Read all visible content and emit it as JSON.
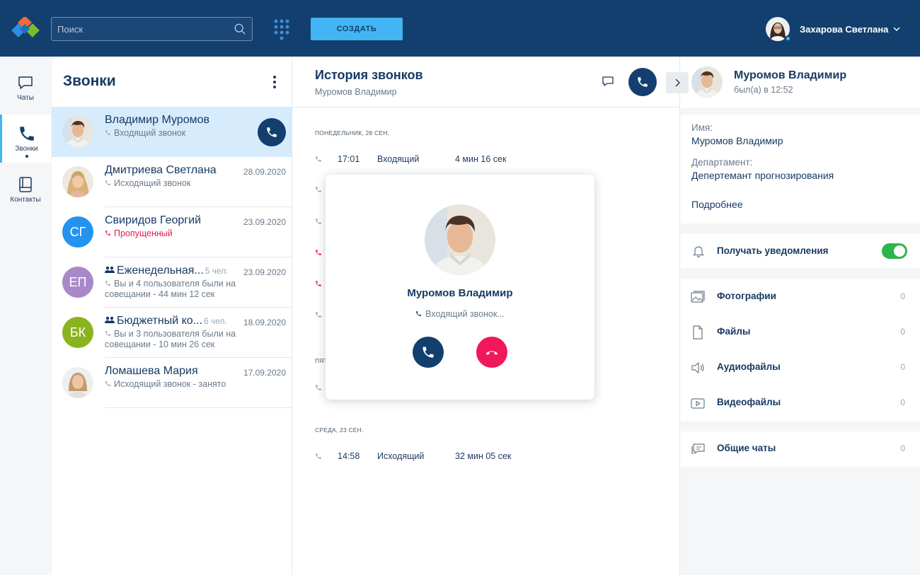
{
  "header": {
    "search_placeholder": "Поиск",
    "create_label": "СОЗДАТЬ",
    "user_name": "Захарова Светлана"
  },
  "rail": {
    "items": [
      {
        "label": "Чаты",
        "icon": "chat-icon"
      },
      {
        "label": "Звонки",
        "icon": "phone-icon"
      },
      {
        "label": "Контакты",
        "icon": "contacts-book-icon"
      }
    ]
  },
  "calls": {
    "title": "Звонки",
    "items": [
      {
        "name": "Владимир Муромов",
        "date": "",
        "sub": "Входящий звонок",
        "type": "incoming",
        "selected": true
      },
      {
        "name": "Дмитриева Светлана",
        "date": "28.09.2020",
        "sub": "Исходящий звонок",
        "type": "outgoing"
      },
      {
        "name": "Свиридов Георгий",
        "date": "23.09.2020",
        "sub": "Пропущенный",
        "type": "missed",
        "initials": "СГ"
      },
      {
        "name": "Еженедельная...",
        "members": "5 чел.",
        "date": "23.09.2020",
        "sub": "Вы и 4 пользователя были на совещании - 44 мин 12 сек",
        "type": "group",
        "initials": "ЕП"
      },
      {
        "name": "Бюджетный ко...",
        "members": "6 чел.",
        "date": "18.09.2020",
        "sub": "Вы и 3 пользователя были на совещании - 10 мин 26 сек",
        "type": "group",
        "initials": "БК"
      },
      {
        "name": "Ломашева Мария",
        "date": "17.09.2020",
        "sub": "Исходящий звонок - занято",
        "type": "outgoing"
      }
    ]
  },
  "history": {
    "title": "История звонков",
    "subtitle": "Муромов Владимир",
    "day1": "ПОНЕДЕЛЬНИК, 28 СЕН.",
    "row1": {
      "time": "17:01",
      "type": "Входящий",
      "duration": "4 мин 16 сек"
    },
    "day2": "ПЯТ",
    "day3": "СРЕДА, 23 СЕН.",
    "row2": {
      "time": "14:58",
      "type": "Исходящий",
      "duration": "32 мин 05 сек"
    }
  },
  "incoming_modal": {
    "name": "Муромов Владимир",
    "status": "Входящий звонок..."
  },
  "profile": {
    "name": "Муромов Владимир",
    "last_seen": "был(а) в 12:52",
    "name_label": "Имя:",
    "name_value": "Муромов Владимир",
    "dept_label": "Департамент:",
    "dept_value": "Депертемант прогнозирования",
    "more_label": "Подробнее",
    "notifications_label": "Получать уведомления",
    "notifications_on": true,
    "media": [
      {
        "label": "Фотографии",
        "count": "0",
        "icon": "photos-icon"
      },
      {
        "label": "Файлы",
        "count": "0",
        "icon": "file-icon"
      },
      {
        "label": "Аудиофайлы",
        "count": "0",
        "icon": "audio-icon"
      },
      {
        "label": "Видеофайлы",
        "count": "0",
        "icon": "video-icon"
      }
    ],
    "shared_chats": {
      "label": "Общие чаты",
      "count": "0",
      "icon": "shared-chats-icon"
    }
  },
  "colors": {
    "header_bg": "#133f6e",
    "accent": "#42b5f5",
    "missed": "#e8194a",
    "decline": "#f0185a",
    "toggle_on": "#2db44a"
  }
}
